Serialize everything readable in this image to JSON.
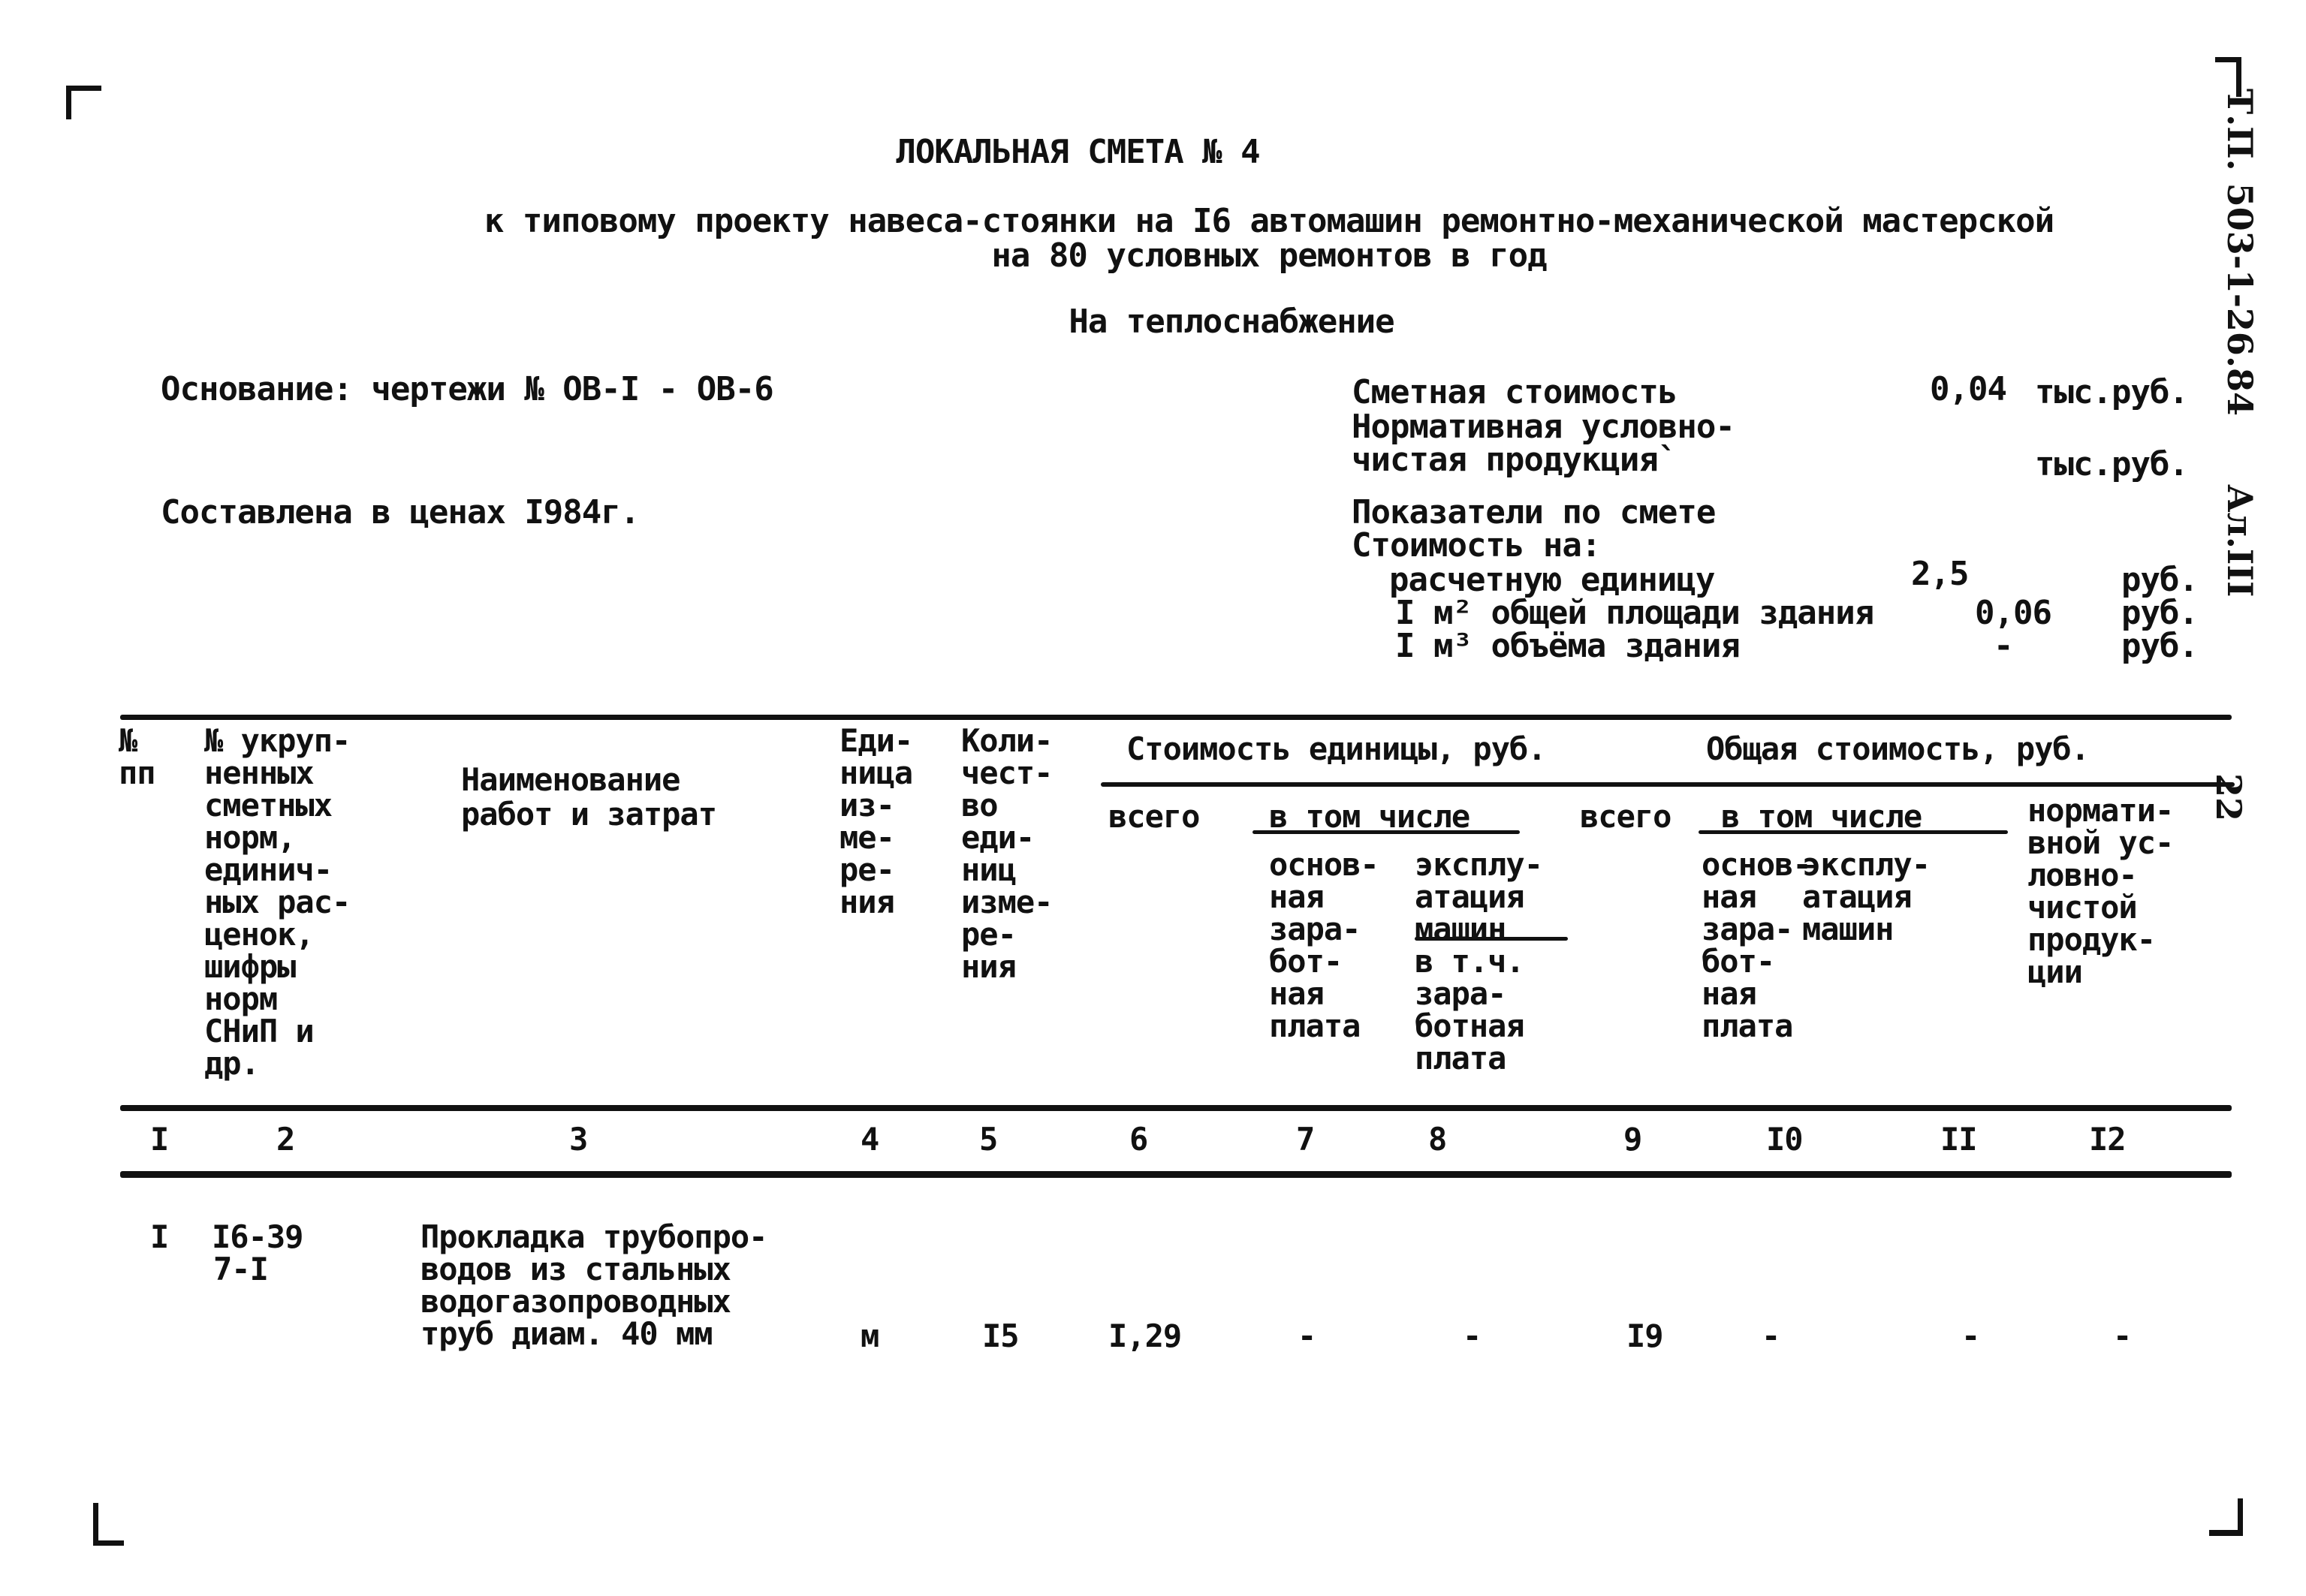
{
  "document": {
    "title": "ЛОКАЛЬНАЯ СМЕТА № 4",
    "subtitle_line1": "к типовому проекту навеса-стоянки на I6 автомашин ремонтно-механической мастерской",
    "subtitle_line2": "на 80 условных ремонтов в год",
    "section": "На теплоснабжение",
    "side_code": "Т.П. 503-1-26.84",
    "side_album": "Ал.III",
    "page_number": "22"
  },
  "basis": {
    "drawings": "Основание: чертежи № ОВ-I - ОВ-6",
    "prices": "Составлена в ценах I984г."
  },
  "summary": {
    "estimate_cost_label": "Сметная стоимость",
    "estimate_cost_value": "0,04",
    "estimate_cost_unit": "тыс.руб.",
    "normative_label_1": "Нормативная условно-",
    "normative_label_2": "чистая продукция`",
    "normative_value": "",
    "normative_unit": "тыс.руб.",
    "indicators_label": "Показатели по смете",
    "cost_on_label": "Стоимость на:",
    "indicators": [
      {
        "label": "расчетную единицу",
        "value": "2,5",
        "unit": "руб."
      },
      {
        "label": "I м² общей площади здания",
        "value": "0,06",
        "unit": "руб."
      },
      {
        "label": "I м³ объёма здания",
        "value": "-",
        "unit": "руб."
      }
    ]
  },
  "table": {
    "headers": {
      "c1": [
        "№",
        "пп"
      ],
      "c2": [
        "№ укруп-",
        "ненных",
        "сметных",
        "норм,",
        "единич-",
        "ных рас-",
        "ценок,",
        "шифры",
        "норм",
        "СНиП и",
        "др."
      ],
      "c3": [
        "Наименование",
        "работ и затрат"
      ],
      "c4": [
        "Еди-",
        "ница",
        "из-",
        "ме-",
        "ре-",
        "ния"
      ],
      "c5": [
        "Коли-",
        "чест-",
        "во",
        "еди-",
        "ниц",
        "изме-",
        "ре-",
        "ния"
      ],
      "unit_cost_group": "Стоимость единицы, руб.",
      "total_cost_group": "Общая стоимость, руб.",
      "c6": "всего",
      "incl_unit": "в том числе",
      "c7": [
        "основ-",
        "ная",
        "зара-",
        "бот-",
        "ная",
        "плата"
      ],
      "c8_top": [
        "эксплу-",
        "атация",
        "машин"
      ],
      "c8_bottom": [
        "в т.ч.",
        "зара-",
        "ботная",
        "плата"
      ],
      "c9": "всего",
      "incl_total": "в том числе",
      "c10": [
        "основ-",
        "ная",
        "зара-",
        "бот-",
        "ная",
        "плата"
      ],
      "c11": [
        "эксплу-",
        "атация",
        "машин"
      ],
      "c12": [
        "нормати-",
        "вной ус-",
        "ловно-",
        "чистой",
        "продук-",
        "ции"
      ]
    },
    "column_numbers": [
      "I",
      "2",
      "3",
      "4",
      "5",
      "6",
      "7",
      "8",
      "9",
      "I0",
      "II",
      "I2"
    ],
    "rows": [
      {
        "no": "I",
        "code_line1": "I6-39",
        "code_line2": "7-I",
        "name": [
          "Прокладка трубопро-",
          "водов из стальных",
          "водогазопроводных",
          "труб диам. 40 мм"
        ],
        "unit": "м",
        "quantity": "I5",
        "unit_total": "I,29",
        "unit_wage": "-",
        "unit_machines": "-",
        "total": "I9",
        "total_wage": "-",
        "total_machines": "-",
        "normative_product": "-"
      }
    ]
  }
}
